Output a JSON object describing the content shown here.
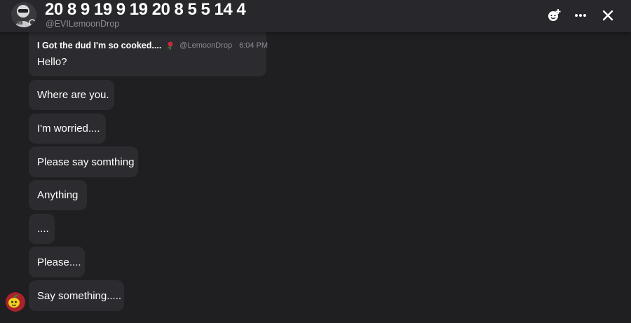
{
  "header": {
    "title": "20 8 9 19 9 19 20 8 5 5 14 4",
    "handle": "@EVILemoonDrop",
    "icons": [
      "add-emoji-icon",
      "more-icon",
      "close-icon"
    ]
  },
  "reply": {
    "name": "I Got the dud I'm so cooked....",
    "emoji": "rose",
    "handle": "@LemoonDrop",
    "time": "6:04 PM"
  },
  "messages": [
    "Hello?",
    "Where are you.",
    "I'm worried....",
    "Please say somthing",
    "Anything",
    "....",
    "Please....",
    "Say something....."
  ],
  "colors": {
    "background": "#1f1e21",
    "header": "#28272b",
    "bubble": "#2c2b30",
    "muted_text": "#8e8c94"
  }
}
